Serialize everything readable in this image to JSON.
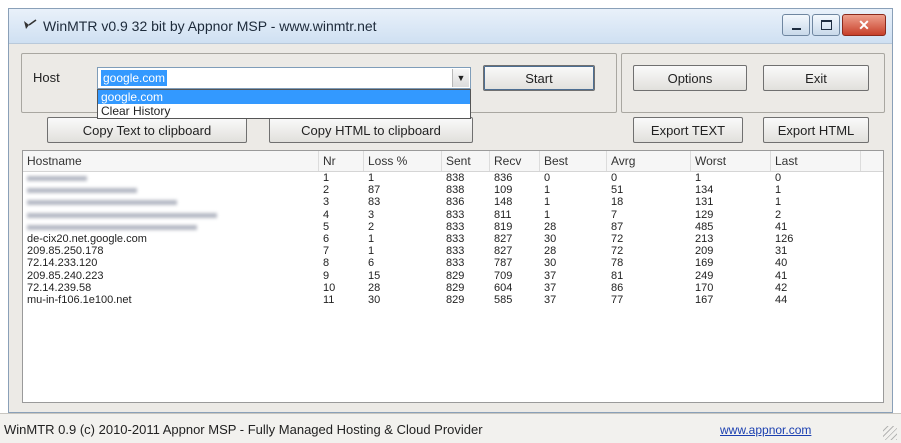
{
  "window": {
    "title": "WinMTR v0.9 32 bit by Appnor MSP - www.winmtr.net",
    "close_glyph": "✕"
  },
  "host": {
    "label": "Host",
    "value": "google.com",
    "dropdown_items": [
      "google.com",
      "Clear History"
    ]
  },
  "buttons": {
    "start": "Start",
    "options": "Options",
    "exit": "Exit",
    "copy_text": "Copy Text to clipboard",
    "copy_html": "Copy HTML to clipboard",
    "export_text": "Export TEXT",
    "export_html": "Export HTML"
  },
  "table": {
    "headers": [
      "Hostname",
      "Nr",
      "Loss %",
      "Sent",
      "Recv",
      "Best",
      "Avrg",
      "Worst",
      "Last"
    ],
    "rows": [
      {
        "host": "",
        "redacted": true,
        "nr": "1",
        "loss": "1",
        "sent": "838",
        "recv": "836",
        "best": "0",
        "avrg": "0",
        "worst": "1",
        "last": "0"
      },
      {
        "host": "",
        "redacted": true,
        "nr": "2",
        "loss": "87",
        "sent": "838",
        "recv": "109",
        "best": "1",
        "avrg": "51",
        "worst": "134",
        "last": "1"
      },
      {
        "host": "",
        "redacted": true,
        "nr": "3",
        "loss": "83",
        "sent": "836",
        "recv": "148",
        "best": "1",
        "avrg": "18",
        "worst": "131",
        "last": "1"
      },
      {
        "host": "",
        "redacted": true,
        "nr": "4",
        "loss": "3",
        "sent": "833",
        "recv": "811",
        "best": "1",
        "avrg": "7",
        "worst": "129",
        "last": "2"
      },
      {
        "host": "",
        "redacted": true,
        "nr": "5",
        "loss": "2",
        "sent": "833",
        "recv": "819",
        "best": "28",
        "avrg": "87",
        "worst": "485",
        "last": "41"
      },
      {
        "host": "de-cix20.net.google.com",
        "redacted": false,
        "nr": "6",
        "loss": "1",
        "sent": "833",
        "recv": "827",
        "best": "30",
        "avrg": "72",
        "worst": "213",
        "last": "126"
      },
      {
        "host": "209.85.250.178",
        "redacted": false,
        "nr": "7",
        "loss": "1",
        "sent": "833",
        "recv": "827",
        "best": "28",
        "avrg": "72",
        "worst": "209",
        "last": "31"
      },
      {
        "host": "72.14.233.120",
        "redacted": false,
        "nr": "8",
        "loss": "6",
        "sent": "833",
        "recv": "787",
        "best": "30",
        "avrg": "78",
        "worst": "169",
        "last": "40"
      },
      {
        "host": "209.85.240.223",
        "redacted": false,
        "nr": "9",
        "loss": "15",
        "sent": "829",
        "recv": "709",
        "best": "37",
        "avrg": "81",
        "worst": "249",
        "last": "41"
      },
      {
        "host": "72.14.239.58",
        "redacted": false,
        "nr": "10",
        "loss": "28",
        "sent": "829",
        "recv": "604",
        "best": "37",
        "avrg": "86",
        "worst": "170",
        "last": "42"
      },
      {
        "host": "mu-in-f106.1e100.net",
        "redacted": false,
        "nr": "11",
        "loss": "30",
        "sent": "829",
        "recv": "585",
        "best": "37",
        "avrg": "77",
        "worst": "167",
        "last": "44"
      }
    ]
  },
  "statusbar": {
    "text": "WinMTR 0.9 (c) 2010-2011 Appnor MSP - Fully Managed Hosting & Cloud Provider",
    "link": "www.appnor.com"
  }
}
